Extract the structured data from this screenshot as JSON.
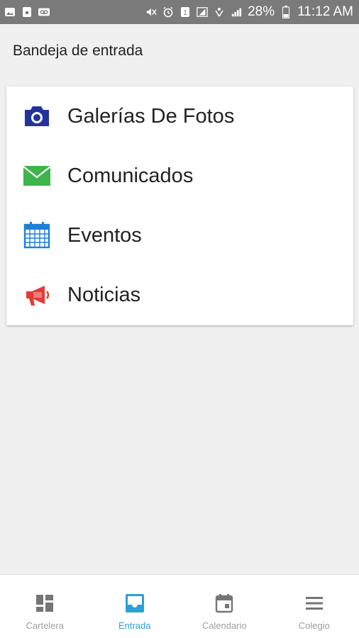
{
  "status_bar": {
    "battery": "28%",
    "time": "11:12 AM",
    "sim_slot": "1",
    "icons_left": [
      "image-icon",
      "lock-icon",
      "voicemail-icon"
    ],
    "icons_right": [
      "mute-icon",
      "alarm-icon",
      "sim-icon",
      "signal-icon",
      "wifi-icon",
      "signal-icon",
      "battery-icon"
    ]
  },
  "page": {
    "title": "Bandeja de entrada"
  },
  "menu": {
    "items": [
      {
        "label": "Galerías De Fotos",
        "icon": "camera-icon",
        "color": "#22349a"
      },
      {
        "label": "Comunicados",
        "icon": "envelope-icon",
        "color": "#3fb44a"
      },
      {
        "label": "Eventos",
        "icon": "calendar-icon",
        "color": "#1f7fd8"
      },
      {
        "label": "Noticias",
        "icon": "megaphone-icon",
        "color": "#e53935"
      }
    ]
  },
  "bottom_nav": {
    "active_color": "#2aa0d6",
    "inactive_color": "#9e9e9e",
    "items": [
      {
        "label": "Cartelera",
        "icon": "dashboard-icon",
        "active": false
      },
      {
        "label": "Entrada",
        "icon": "inbox-icon",
        "active": true
      },
      {
        "label": "Calendario",
        "icon": "calendar-icon",
        "active": false
      },
      {
        "label": "Colegio",
        "icon": "menu-icon",
        "active": false
      }
    ]
  }
}
